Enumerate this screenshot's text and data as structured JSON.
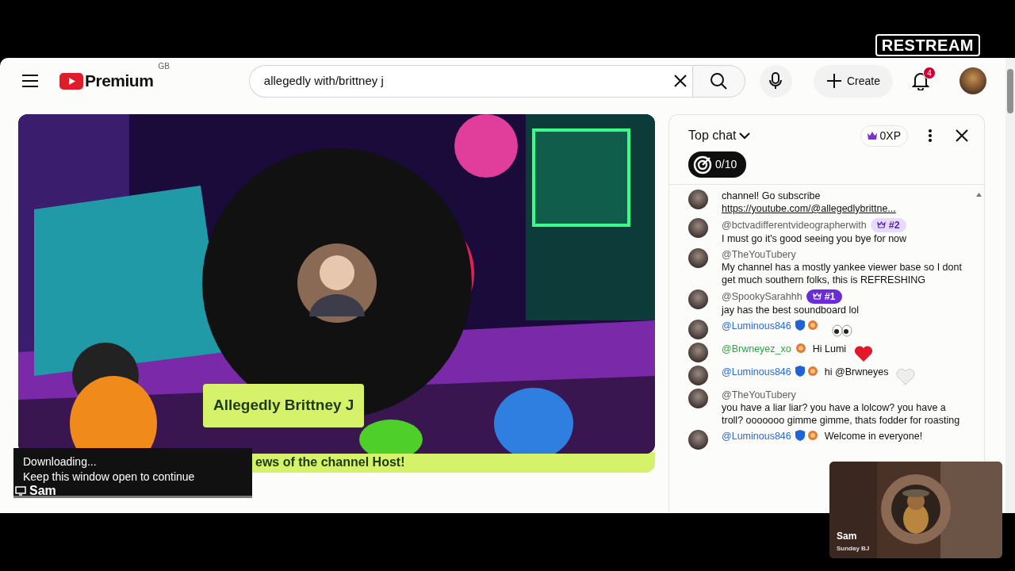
{
  "overlay_logo": "RESTREAM",
  "masthead": {
    "logo_text": "Premium",
    "region": "GB",
    "search": {
      "value": "allegedly with/brittney j"
    },
    "create_label": "Create",
    "notification_count": "4"
  },
  "video": {
    "name_label": "Allegedly Brittney J",
    "ticker": "ews of the channel Host!"
  },
  "chat": {
    "title": "Top chat",
    "xp": "0XP",
    "goal": "0/10",
    "messages": [
      {
        "text": "channel! Go subscribe",
        "link": "https://youtube.com/@allegedlybrittne..."
      },
      {
        "author": "@bctvadifferentvideographerwith",
        "color": "#606060",
        "rank": {
          "label": "#2",
          "filled": false
        },
        "text": "I must go it's good seeing you bye for now"
      },
      {
        "author": "@TheYouTubery",
        "color": "#606060",
        "text": "My channel has a mostly yankee viewer base so I dont get much southern folks, this is REFRESHING"
      },
      {
        "author": "@SpookySarahhh",
        "color": "#606060",
        "rank": {
          "label": "#1",
          "filled": true
        },
        "text": "jay has the best soundboard lol"
      },
      {
        "author": "@Luminous846",
        "color": "#2b6ad0",
        "moderator": true,
        "member": true,
        "kind": "eyes"
      },
      {
        "author": "@Brwneyez_xo",
        "color": "#2ba640",
        "member": true,
        "text": "Hi Lumi",
        "kind": "heart"
      },
      {
        "author": "@Luminous846",
        "color": "#2b6ad0",
        "moderator": true,
        "member": true,
        "text": "hi @Brwneyes",
        "kind": "paleheart"
      },
      {
        "author": "@TheYouTubery",
        "color": "#606060",
        "text": "you have a liar liar? you have a lolcow? you have a troll? ooooooo gimme gimme, thats fodder for roasting"
      },
      {
        "author": "@Luminous846",
        "color": "#2b6ad0",
        "moderator": true,
        "member": true,
        "text": "Welcome in everyone!"
      }
    ]
  },
  "toast": {
    "title": "Downloading...",
    "message": "Keep this window open to continue",
    "source": "Sam"
  },
  "camera": {
    "name": "Sam",
    "subtitle": "Sunday BJ"
  }
}
